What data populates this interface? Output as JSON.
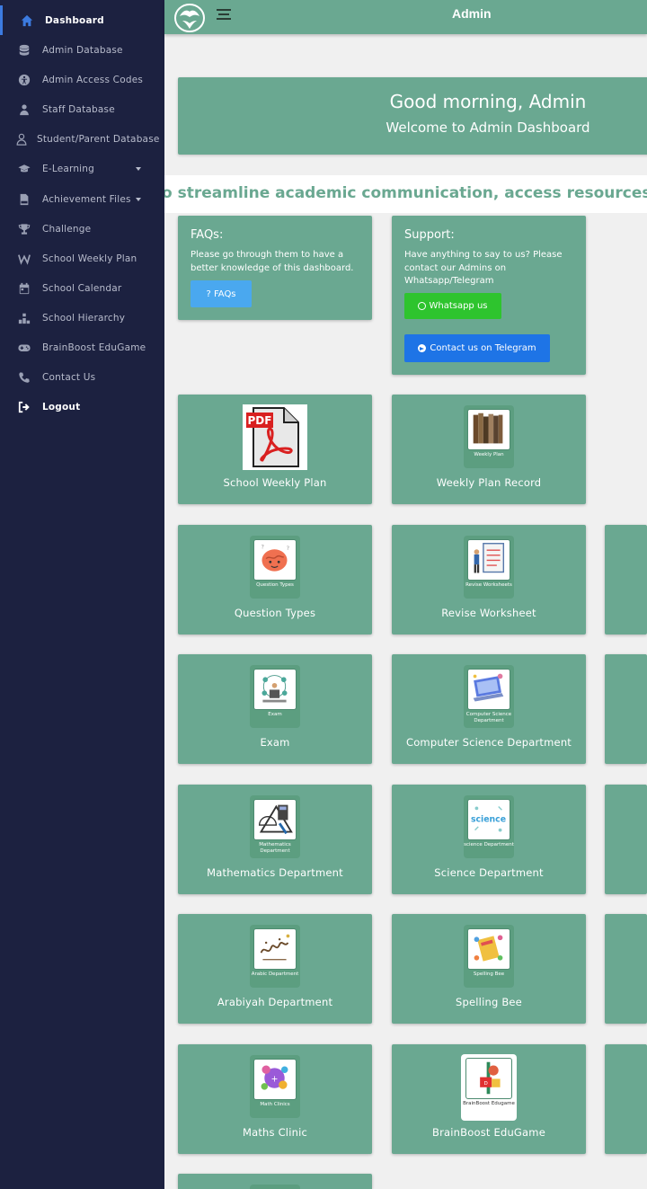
{
  "sidebar": {
    "items": [
      {
        "label": "Dashboard",
        "icon": "home-icon"
      },
      {
        "label": "Admin Database",
        "icon": "database-icon"
      },
      {
        "label": "Admin Access Codes",
        "icon": "accessibility-icon"
      },
      {
        "label": "Staff Database",
        "icon": "staff-icon"
      },
      {
        "label": "Student/Parent Database",
        "icon": "user-icon"
      },
      {
        "label": "E-Learning",
        "icon": "graduation-cap-icon"
      },
      {
        "label": "Achievement Files",
        "icon": "pdf-file-icon"
      },
      {
        "label": "Challenge",
        "icon": "trophy-icon"
      },
      {
        "label": "School Weekly Plan",
        "icon": "w-letter-icon"
      },
      {
        "label": "School Calendar",
        "icon": "calendar-icon"
      },
      {
        "label": "School Hierarchy",
        "icon": "hierarchy-icon"
      },
      {
        "label": "BrainBoost EduGame",
        "icon": "gamepad-icon"
      },
      {
        "label": "Contact Us",
        "icon": "phone-icon"
      },
      {
        "label": "Logout",
        "icon": "logout-icon"
      }
    ]
  },
  "header": {
    "title": "Admin"
  },
  "greeting": {
    "title": "Good morning, Admin",
    "subtitle": "Welcome to Admin Dashboard"
  },
  "marquee": {
    "text": "o streamline academic communication, access resources, and s"
  },
  "faqs": {
    "title": "FAQs:",
    "text": "Please go through them to have a better knowledge of this dashboard.",
    "button": "? FAQs"
  },
  "support": {
    "title": "Support:",
    "text": "Have anything to say to us? Please contact our Admins on Whatsapp/Telegram",
    "whatsapp_button": "Whatsapp us",
    "telegram_button": "Contact us on Telegram"
  },
  "tiles": [
    {
      "label": "School Weekly Plan",
      "caption": ""
    },
    {
      "label": "Weekly Plan Record",
      "caption": "Weekly Plan"
    },
    {
      "label": "Question Types",
      "caption": "Question Types"
    },
    {
      "label": "Revise Worksheet",
      "caption": "Revise Worksheets"
    },
    {
      "label": "Exam",
      "caption": "Exam"
    },
    {
      "label": "Computer Science Department",
      "caption": "Computer Science Department"
    },
    {
      "label": "Mathematics Department",
      "caption": "Mathematics Department"
    },
    {
      "label": "Science Department",
      "caption": "science Department"
    },
    {
      "label": "Arabiyah Department",
      "caption": "Arabic Department"
    },
    {
      "label": "Spelling Bee",
      "caption": "Spelling Bee"
    },
    {
      "label": "Maths Clinic",
      "caption": "Math Clinics"
    },
    {
      "label": "BrainBoost EduGame",
      "caption": "BrainBoost Edugame"
    }
  ],
  "colors": {
    "sidebar": "#1c2140",
    "accent": "#6aa891",
    "whatsapp": "#2ec42e",
    "telegram": "#1e74e6",
    "faq": "#4aa8ef"
  }
}
